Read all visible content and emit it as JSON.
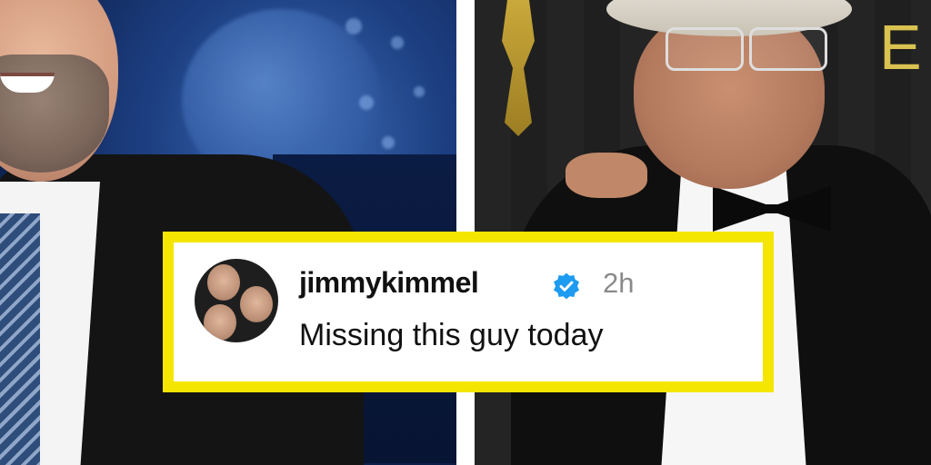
{
  "post": {
    "username": "jimmykimmel",
    "time": "2h",
    "caption": "Missing this guy today",
    "verified": true,
    "verified_icon": "verified-badge-icon"
  },
  "colors": {
    "card_border": "#f4e600",
    "verified_blue": "#1d9bf0",
    "time_gray": "#8a8a8a",
    "divider": "#ffffff"
  }
}
